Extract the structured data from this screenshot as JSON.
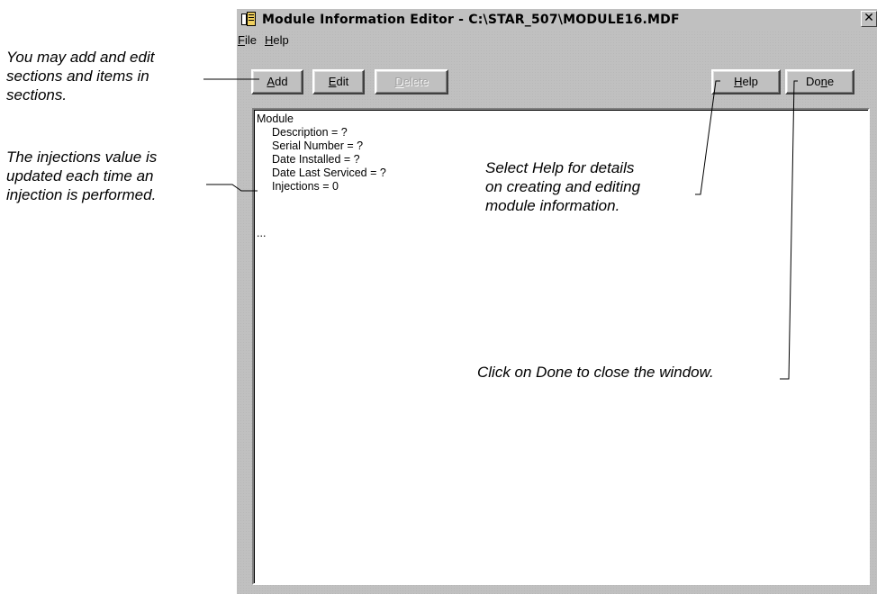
{
  "callouts": {
    "add_edit": [
      "You may add and edit",
      "sections and items in",
      "sections."
    ],
    "injections": [
      "The injections value is",
      "updated each time an",
      "injection is performed."
    ],
    "help": [
      "Select Help for details",
      "on creating and editing",
      "module information."
    ],
    "done": "Click on Done to close the window."
  },
  "window": {
    "title": "Module Information Editor - C:\\STAR_507\\MODULE16.MDF",
    "close_glyph": "✕"
  },
  "menu": {
    "file": {
      "mnemonic": "F",
      "rest": "ile"
    },
    "help": {
      "mnemonic": "H",
      "rest": "elp"
    }
  },
  "toolbar": {
    "add": {
      "mnemonic": "A",
      "rest": "dd"
    },
    "edit": {
      "mnemonic": "E",
      "rest": "dit"
    },
    "delete": {
      "mnemonic": "D",
      "rest": "elete"
    },
    "help": {
      "mnemonic": "H",
      "rest": "elp"
    },
    "done": {
      "pre": "Do",
      "mnemonic": "n",
      "rest": "e"
    }
  },
  "tree": {
    "root": "Module",
    "items": [
      "Description = ?",
      "Serial Number = ?",
      "Date Installed = ?",
      "Date Last Serviced = ?",
      "Injections = 0"
    ],
    "more": "..."
  },
  "colors": {
    "window_face": "#c0c0c0",
    "shadow": "#808080",
    "highlight": "#ffffff",
    "disabled_text": "#a0a0a0"
  }
}
